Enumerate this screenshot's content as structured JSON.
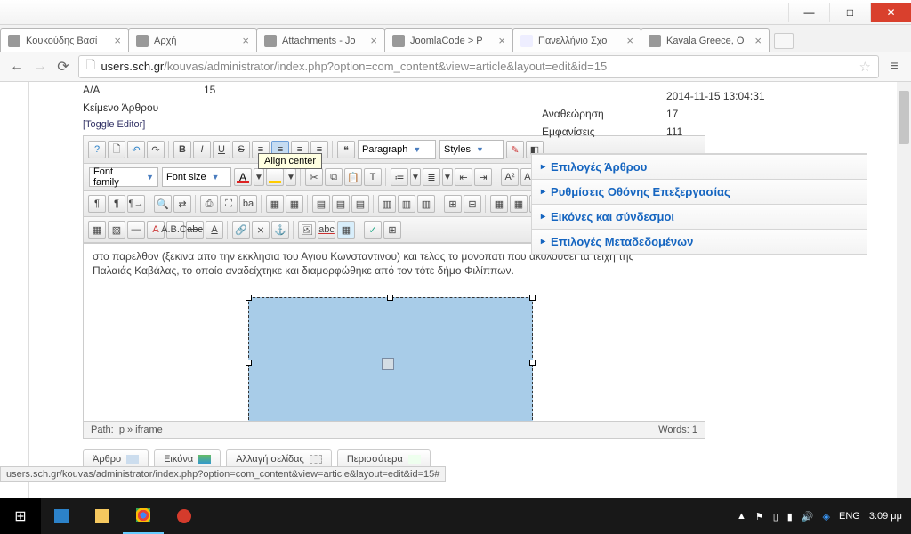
{
  "window": {
    "minimize": "—",
    "maximize": "□",
    "close": "✕"
  },
  "tabs": [
    {
      "label": "Κουκούδης Βασί",
      "fav": "favjo"
    },
    {
      "label": "Αρχή",
      "fav": "favjo"
    },
    {
      "label": "Attachments - Jo",
      "fav": "favjc"
    },
    {
      "label": "JoomlaCode > P",
      "fav": "favblue"
    },
    {
      "label": "Πανελλήνιο Σχο",
      "fav": ""
    },
    {
      "label": "Kavala Greece, O",
      "fav": "favyt"
    }
  ],
  "url": {
    "host": "users.sch.gr",
    "path": "/kouvas/administrator/index.php?option=com_content&view=article&layout=edit&id=15"
  },
  "fields": {
    "aa_label": "A/A",
    "aa_value": "15",
    "body_label": "Κείμενο Άρθρου"
  },
  "editor": {
    "toggle": "[Toggle Editor]",
    "paragraph": "Paragraph",
    "styles": "Styles",
    "ffamily": "Font family",
    "fsize": "Font size",
    "tooltip": "Align center",
    "text1": "στο παρελθον (ξεκινα απο την εκκλησια του Αγιου Κωνσταντινου) και τελος το μονοπατι που ακολουθει τα τειχη της",
    "text2": "Παλαιάς Καβάλας, το οποίο αναδείχτηκε και διαμορφώθηκε από τον τότε δήμο Φιλίππων.",
    "path_label": "Path:",
    "path_value": "p » iframe",
    "words_label": "Words:",
    "words_value": "1"
  },
  "pills": {
    "article": "Άρθρο",
    "image": "Εικόνα",
    "pagebreak": "Αλλαγή σελίδας",
    "readmore": "Περισσότερα"
  },
  "meta": {
    "date": "2014-11-15 13:04:31",
    "rev_label": "Αναθεώρηση",
    "rev": "17",
    "hits_label": "Εμφανίσεις",
    "hits": "111"
  },
  "acc": {
    "opts": "Επιλογές Άρθρου",
    "screen": "Ρυθμίσεις Οθόνης Επεξεργασίας",
    "img": "Εικόνες και σύνδεσμοι",
    "metadata": "Επιλογές Μεταδεδομένων"
  },
  "statuslink": "users.sch.gr/kouvas/administrator/index.php?option=com_content&view=article&layout=edit&id=15#",
  "tray": {
    "lang": "ENG",
    "time": "3:09 μμ",
    "up": "▲"
  }
}
